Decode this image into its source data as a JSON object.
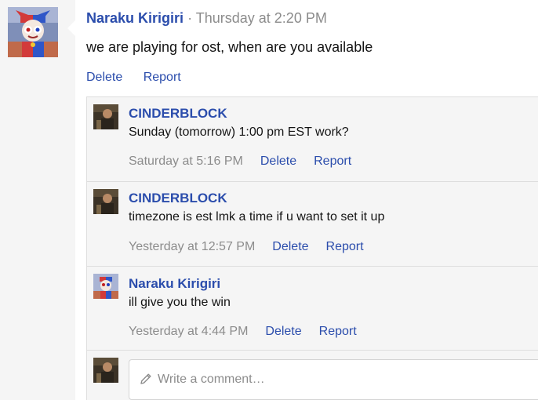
{
  "post": {
    "author": "Naraku Kirigiri",
    "separator": "·",
    "time": "Thursday at 2:20 PM",
    "body": "we are playing for ost, when are you available",
    "actions": {
      "delete": "Delete",
      "report": "Report"
    }
  },
  "comments": [
    {
      "author": "CINDERBLOCK",
      "text": "Sunday (tomorrow) 1:00 pm EST work?",
      "time": "Saturday at 5:16 PM",
      "delete": "Delete",
      "report": "Report"
    },
    {
      "author": "CINDERBLOCK",
      "text": "timezone is est lmk a time if u want to set it up",
      "time": "Yesterday at 12:57 PM",
      "delete": "Delete",
      "report": "Report"
    },
    {
      "author": "Naraku Kirigiri",
      "text": "ill give you the win",
      "time": "Yesterday at 4:44 PM",
      "delete": "Delete",
      "report": "Report"
    }
  ],
  "composer": {
    "placeholder": "Write a comment…",
    "icon": "pencil-icon"
  },
  "colors": {
    "link": "#2b4dac",
    "muted": "#8c8c8c",
    "panel": "#f5f5f5"
  }
}
